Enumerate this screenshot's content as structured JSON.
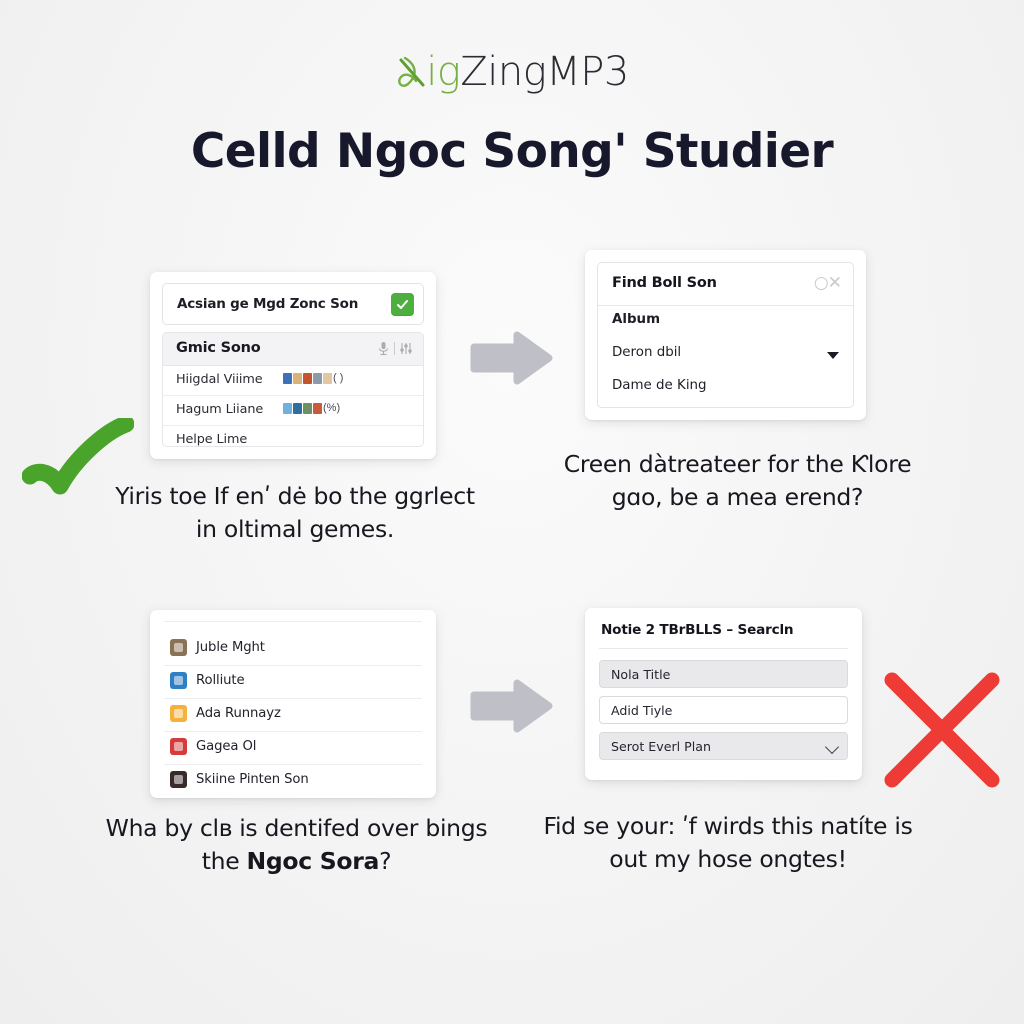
{
  "brand": {
    "icon": "leaf-x-logo",
    "name_green": "ig",
    "name_dark": "ZingMP3",
    "accent": "#76b043"
  },
  "header": {
    "title": "Celld Ngoc Song' Studier"
  },
  "panels": {
    "top_left": {
      "search_row": {
        "label": "Acsian ge Mgd Zonc Son",
        "badge_icon": "check-badge",
        "badge_color": "#4caf3e"
      },
      "section": {
        "title": "Gmic Sono",
        "icons": [
          "mic-icon",
          "sliders-icon"
        ],
        "rows": [
          {
            "name": "Hiigdal Viiime",
            "meta": "(     )"
          },
          {
            "name": "Hagum Liiane",
            "meta": "(%)"
          },
          {
            "name": "Helpe Lime",
            "meta": ""
          }
        ]
      }
    },
    "top_right": {
      "header": {
        "title": "Find Boll Son",
        "close_icon": "close-x-icon",
        "close_label": "○✕"
      },
      "rows": [
        {
          "label": "Album",
          "strong": true,
          "caret": false
        },
        {
          "label": "Deron dbil",
          "strong": false,
          "caret": true
        },
        {
          "label": "Dame de King",
          "strong": false,
          "caret": false
        }
      ]
    },
    "bottom_left": {
      "items": [
        {
          "label": "Juble Mght",
          "color": "#8a7256"
        },
        {
          "label": "Rolliute",
          "color": "#2e7fc4"
        },
        {
          "label": "Ada Runnayz",
          "color": "#f4b23c"
        },
        {
          "label": "Gagea Ol",
          "color": "#d63b3b"
        },
        {
          "label": "Skiine Pinten Son",
          "color": "#3a2b2b"
        }
      ]
    },
    "bottom_right": {
      "title": "Notie 2 TBrBLLS – Searcln",
      "fields": [
        {
          "value": "Nola Title",
          "style": "filled",
          "chevron": false
        },
        {
          "value": "Adid Tiyle",
          "style": "plain",
          "chevron": false
        },
        {
          "value": "Serot Everl Plan",
          "style": "filled",
          "chevron": true
        }
      ]
    }
  },
  "captions": {
    "top_left": "Yiris toe If enʹ dė bo the ggrlect in oltimal gemes.",
    "top_right": "Creen dàtreateer for the Ƙlore gɑo, be a mea erend?",
    "bottom_left_part1": "Wha by clʙ is dentifed over bings the ",
    "bottom_left_bold": "Ngoc Sora",
    "bottom_left_part2": "?",
    "bottom_right": "Fid se your: ʹf wirds this natíte is out my hose ongtes!"
  },
  "marks": {
    "check": {
      "icon": "green-check-icon",
      "color": "#4aa32b"
    },
    "cross": {
      "icon": "red-cross-icon",
      "color": "#ee3b35"
    }
  },
  "arrows": {
    "icon": "arrow-right-icon",
    "color": "#bfc0c7"
  }
}
